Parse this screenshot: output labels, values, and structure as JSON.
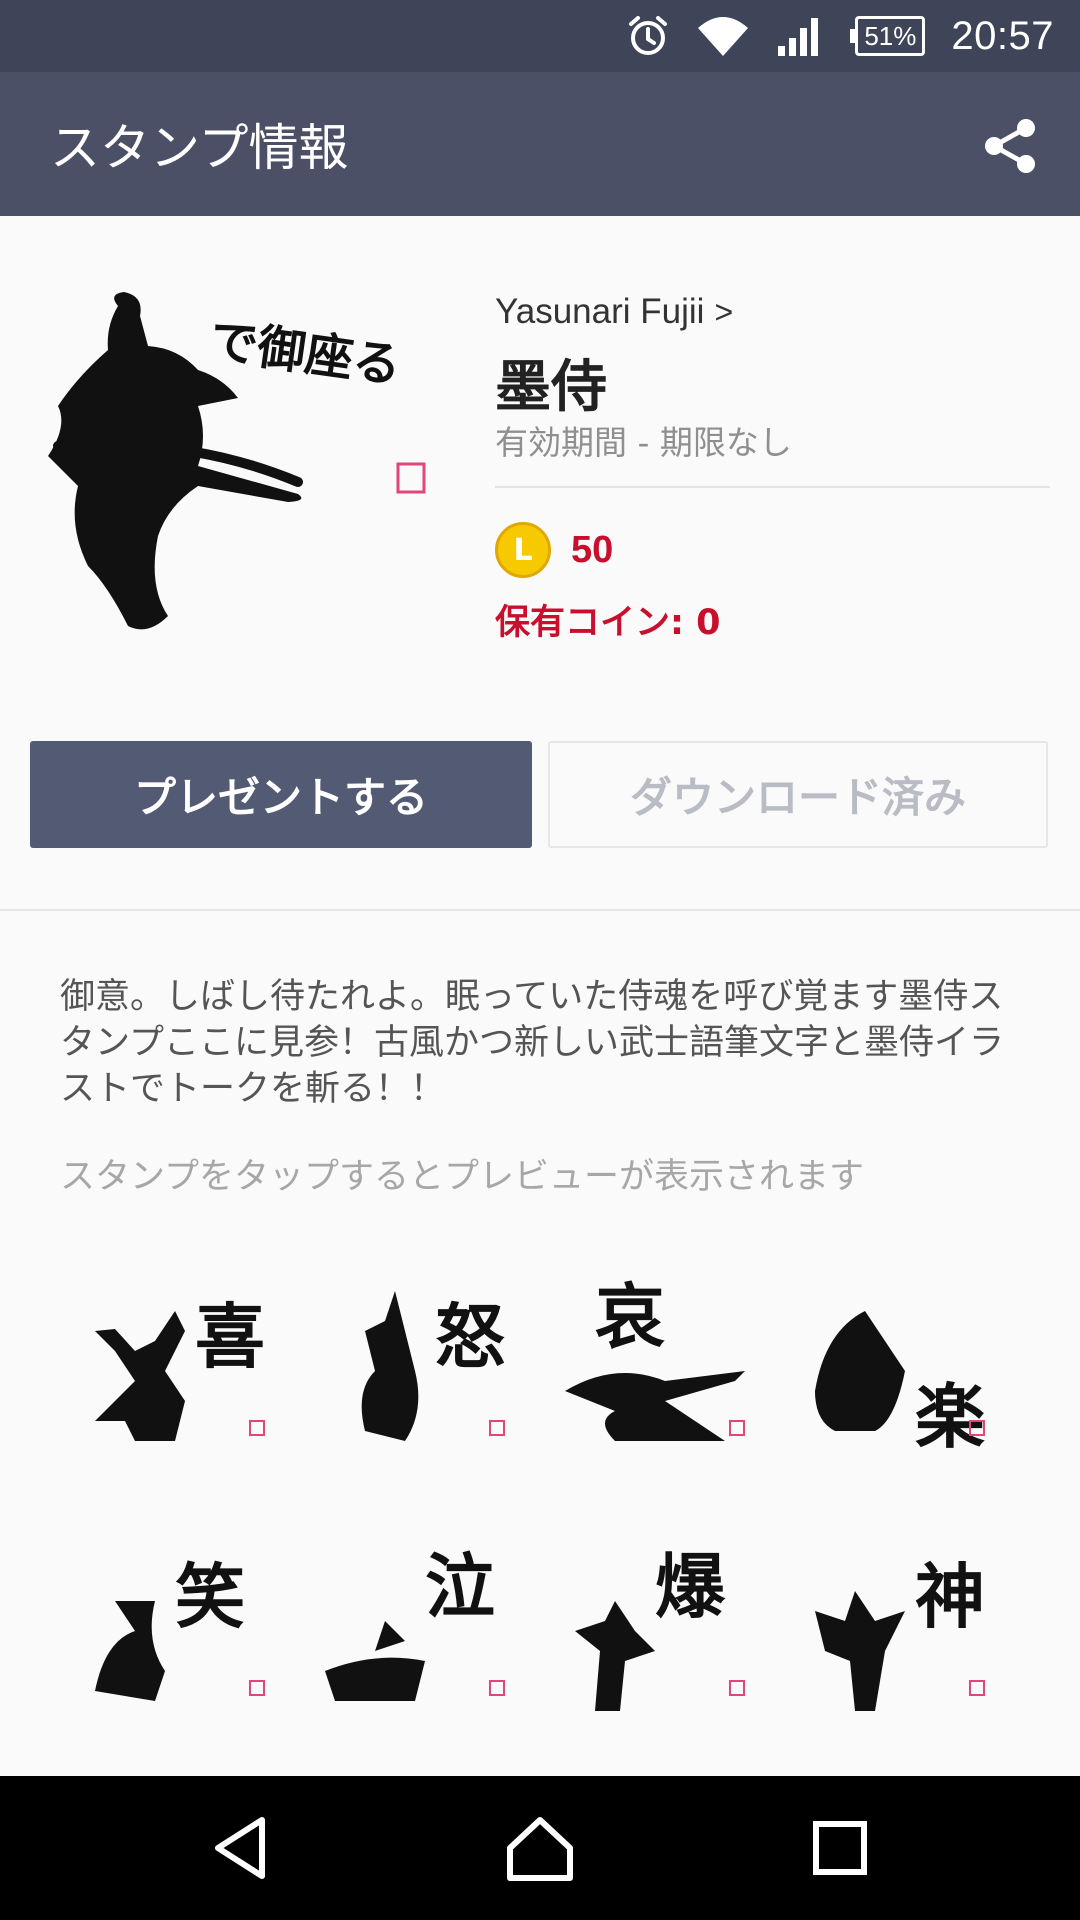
{
  "status_bar": {
    "battery": "51%",
    "time": "20:57",
    "icons": [
      "alarm-icon",
      "wifi-icon",
      "signal-icon",
      "battery-icon"
    ]
  },
  "app_bar": {
    "title": "スタンプ情報",
    "action_icon": "share-icon"
  },
  "package": {
    "author": "Yasunari Fujii",
    "title": "墨侍",
    "validity": "有効期間 - 期限なし",
    "price": "50",
    "coin_letter": "L",
    "owned_coins": "保有コイン: 0",
    "hero_caption": "で御座る"
  },
  "buttons": {
    "gift": "プレゼントする",
    "download": "ダウンロード済み"
  },
  "description": "御意。しばし待たれよ。眠っていた侍魂を呼び覚ます墨侍スタンプここに見参！古風かつ新しい武士語筆文字と墨侍イラストでトークを斬る！！",
  "preview_hint": "スタンプをタップするとプレビューが表示されます",
  "stickers": [
    {
      "label": "喜"
    },
    {
      "label": "怒"
    },
    {
      "label": "哀"
    },
    {
      "label": "楽"
    },
    {
      "label": "笑"
    },
    {
      "label": "泣"
    },
    {
      "label": "爆"
    },
    {
      "label": "神"
    }
  ],
  "colors": {
    "status_bar": "#3f4558",
    "app_bar": "#4b5066",
    "gift_button": "#535a74",
    "price_red": "#c8102e",
    "coin_gold": "#f7c900"
  },
  "nav_bar": {
    "icons": [
      "back-icon",
      "home-icon",
      "recents-icon"
    ]
  }
}
